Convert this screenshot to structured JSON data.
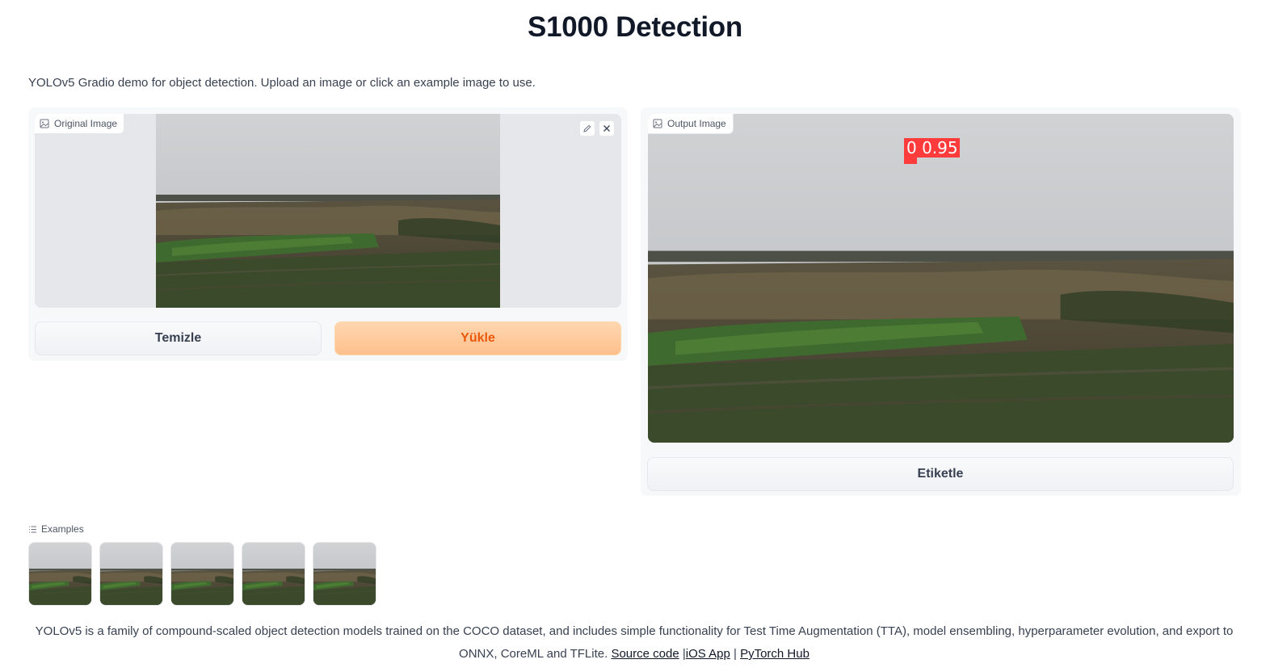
{
  "header": {
    "title": "S1000 Detection",
    "description": "YOLOv5 Gradio demo for object detection. Upload an image or click an example image to use."
  },
  "input_panel": {
    "label": "Original Image",
    "clear_button": "Temizle",
    "submit_button": "Yükle"
  },
  "output_panel": {
    "label": "Output Image",
    "detection_label": "0 0.95",
    "detection_color": "#ff3b3b",
    "label_button": "Etiketle"
  },
  "examples": {
    "label": "Examples",
    "count": 5
  },
  "footer": {
    "text": "YOLOv5 is a family of compound-scaled object detection models trained on the COCO dataset, and includes simple functionality for Test Time Augmentation (TTA), model ensembling, hyperparameter evolution, and export to ONNX, CoreML and TFLite.",
    "links": [
      {
        "label": "Source code"
      },
      {
        "label": "iOS App"
      },
      {
        "label": "PyTorch Hub"
      }
    ],
    "separator": "|"
  },
  "colors": {
    "primary_button_text": "#ea580c",
    "primary_button_bg": "#fdc08c"
  }
}
